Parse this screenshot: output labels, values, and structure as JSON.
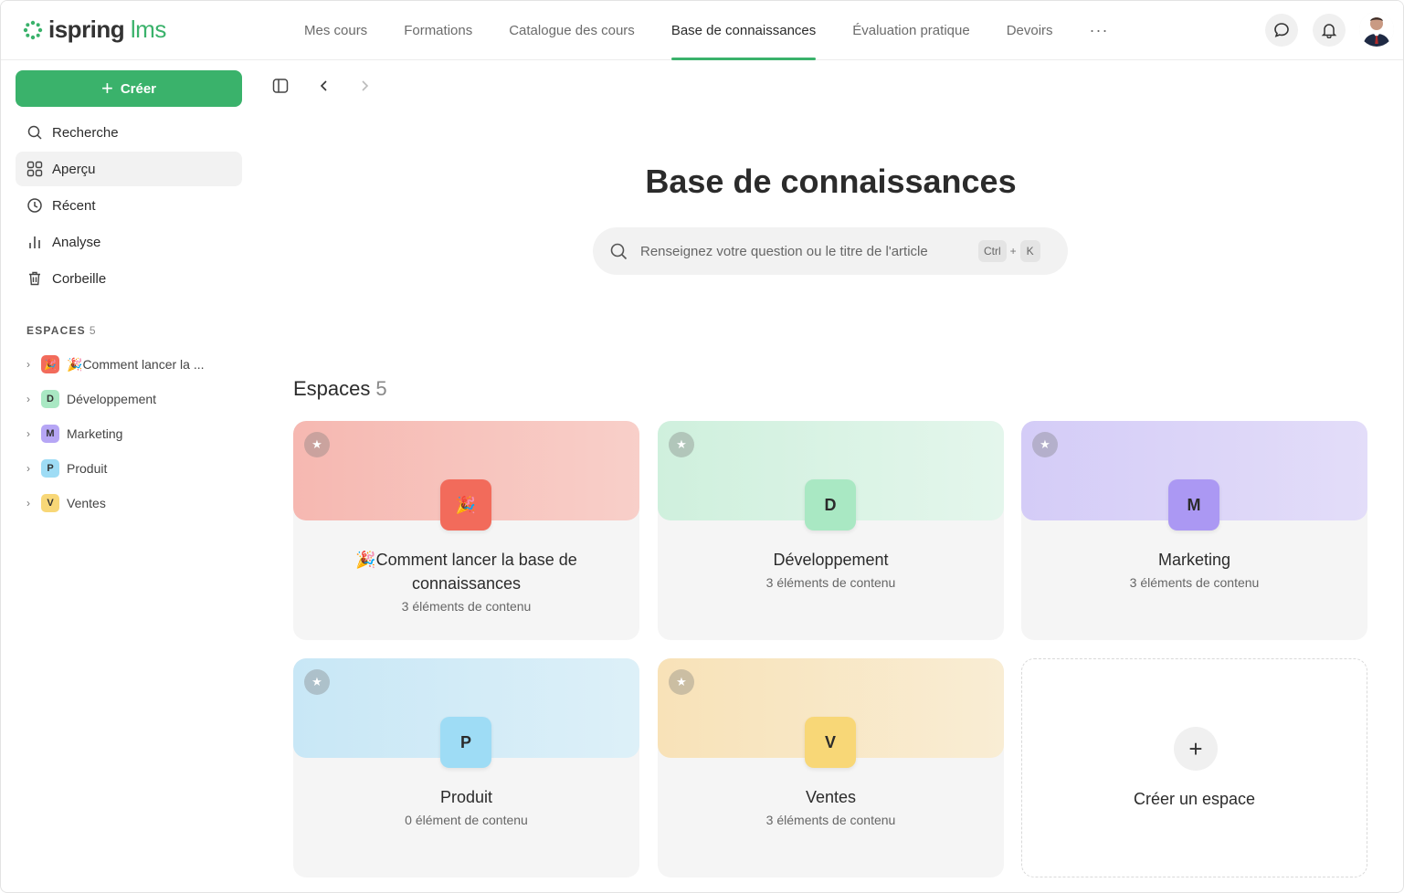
{
  "app": {
    "logo_main": "ispring",
    "logo_suffix": "lms"
  },
  "nav": {
    "items": [
      {
        "label": "Mes cours"
      },
      {
        "label": "Formations"
      },
      {
        "label": "Catalogue des cours"
      },
      {
        "label": "Base de connaissances"
      },
      {
        "label": "Évaluation pratique"
      },
      {
        "label": "Devoirs"
      }
    ],
    "active_index": 3,
    "more_label": "···"
  },
  "sidebar": {
    "create_label": "Créer",
    "items": [
      {
        "label": "Recherche",
        "icon": "search-icon"
      },
      {
        "label": "Aperçu",
        "icon": "grid-icon"
      },
      {
        "label": "Récent",
        "icon": "clock-icon"
      },
      {
        "label": "Analyse",
        "icon": "bar-chart-icon"
      },
      {
        "label": "Corbeille",
        "icon": "trash-icon"
      }
    ],
    "active_index": 1,
    "espaces_title": "ESPACES",
    "espaces_count": "5",
    "spaces": [
      {
        "badge": "🎉",
        "label": "Comment lancer la ...",
        "color": "#f26b5b"
      },
      {
        "badge": "D",
        "label": "Développement",
        "color": "#a9e8c3"
      },
      {
        "badge": "M",
        "label": "Marketing",
        "color": "#b6a6f5"
      },
      {
        "badge": "P",
        "label": "Produit",
        "color": "#9edcf5"
      },
      {
        "badge": "V",
        "label": "Ventes",
        "color": "#f8d777"
      }
    ]
  },
  "main": {
    "title": "Base de connaissances",
    "search_placeholder": "Renseignez votre question ou le titre de l'article",
    "shortcut_ctrl": "Ctrl",
    "shortcut_plus": "+",
    "shortcut_key": "K",
    "section_title": "Espaces",
    "section_count": "5",
    "cards": [
      {
        "title": "Comment lancer la base de connaissances",
        "subtitle": "3 éléments de contenu",
        "tile": "🎉",
        "tile_color": "#f26b5b",
        "banner_color": "#f6c6c1"
      },
      {
        "title": "Développement",
        "subtitle": "3 éléments de contenu",
        "tile": "D",
        "tile_color": "#a9e8c3",
        "banner_color": "#d6f2e2"
      },
      {
        "title": "Marketing",
        "subtitle": "3 éléments de contenu",
        "tile": "M",
        "tile_color": "#ab98f3",
        "banner_color": "#dcd6f8"
      },
      {
        "title": "Produit",
        "subtitle": "0 élément de contenu",
        "tile": "P",
        "tile_color": "#9edcf5",
        "banner_color": "#d3ecf7"
      },
      {
        "title": "Ventes",
        "subtitle": "3 éléments de contenu",
        "tile": "V",
        "tile_color": "#f8d777",
        "banner_color": "#f8e8c6"
      }
    ],
    "create_space_label": "Créer un espace",
    "create_space_plus": "+"
  },
  "colors": {
    "accent": "#3ab26b"
  }
}
